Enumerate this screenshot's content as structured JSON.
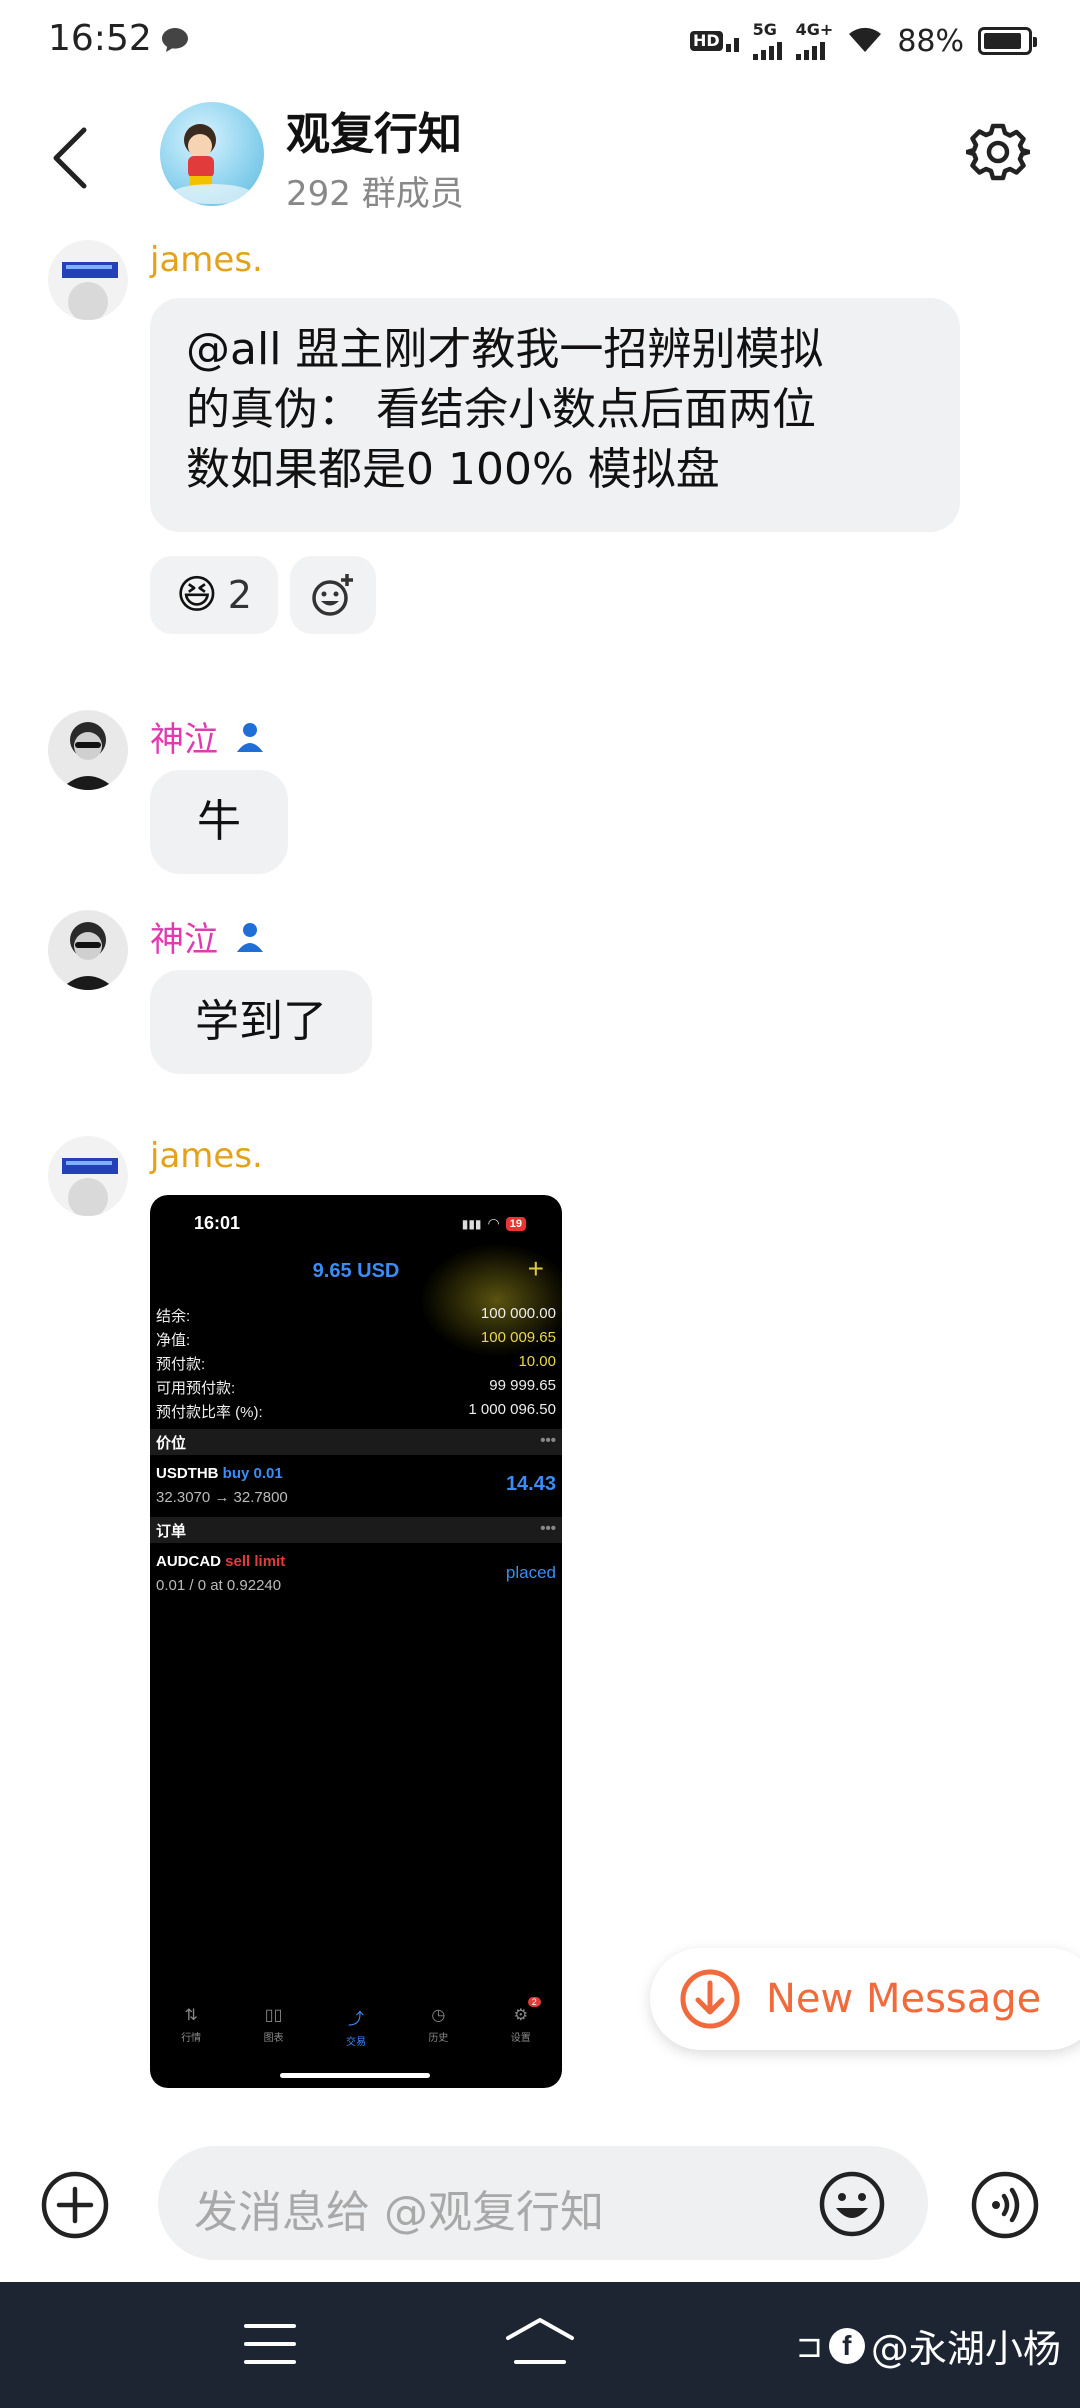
{
  "status_bar": {
    "time": "16:52",
    "network_hd": "HD",
    "network_5g": "5G",
    "network_4g": "4G+",
    "battery": "88%"
  },
  "header": {
    "title": "观复行知",
    "members": "292 群成员"
  },
  "messages": [
    {
      "sender": "james.",
      "text_lines": [
        "@all 盟主刚才教我一招辨别模拟",
        "的真伪： 看结余小数点后面两位",
        "数如果都是0 100% 模拟盘"
      ],
      "reaction": {
        "emoji": "😆",
        "count": "2"
      }
    },
    {
      "sender": "神泣",
      "text": "牛"
    },
    {
      "sender": "神泣",
      "text": "学到了"
    },
    {
      "sender": "james.",
      "type": "image"
    }
  ],
  "screenshot": {
    "time": "16:01",
    "battery": "19",
    "balance_title": "9.65 USD",
    "rows": [
      {
        "label": "结余:",
        "value": "100 000.00"
      },
      {
        "label": "净值:",
        "value": "100 009.65"
      },
      {
        "label": "预付款:",
        "value": "10.00"
      },
      {
        "label": "可用预付款:",
        "value": "99 999.65"
      },
      {
        "label": "预付款比率 (%):",
        "value": "1 000 096.50"
      }
    ],
    "positions_header": "价位",
    "position": {
      "symbol": "USDTHB",
      "side": "buy 0.01",
      "prices": "32.3070 → 32.7800",
      "profit": "14.43"
    },
    "orders_header": "订单",
    "order": {
      "symbol": "AUDCAD",
      "side": "sell limit",
      "detail": "0.01 / 0 at 0.92240",
      "status": "placed"
    },
    "tabs": [
      "行情",
      "图表",
      "交易",
      "历史",
      "设置"
    ],
    "settings_badge": "2",
    "more": "•••"
  },
  "new_message": {
    "label": "New Message"
  },
  "input": {
    "placeholder": "发消息给  @观复行知"
  },
  "watermark": {
    "badge": "f",
    "text": "@永湖小杨"
  },
  "colors": {
    "accent_orange": "#f06a3c",
    "james_name": "#e3a21a",
    "shenqi_name": "#e03cb0",
    "bubble": "#f0f1f3",
    "nav_bar": "#1d2532"
  }
}
